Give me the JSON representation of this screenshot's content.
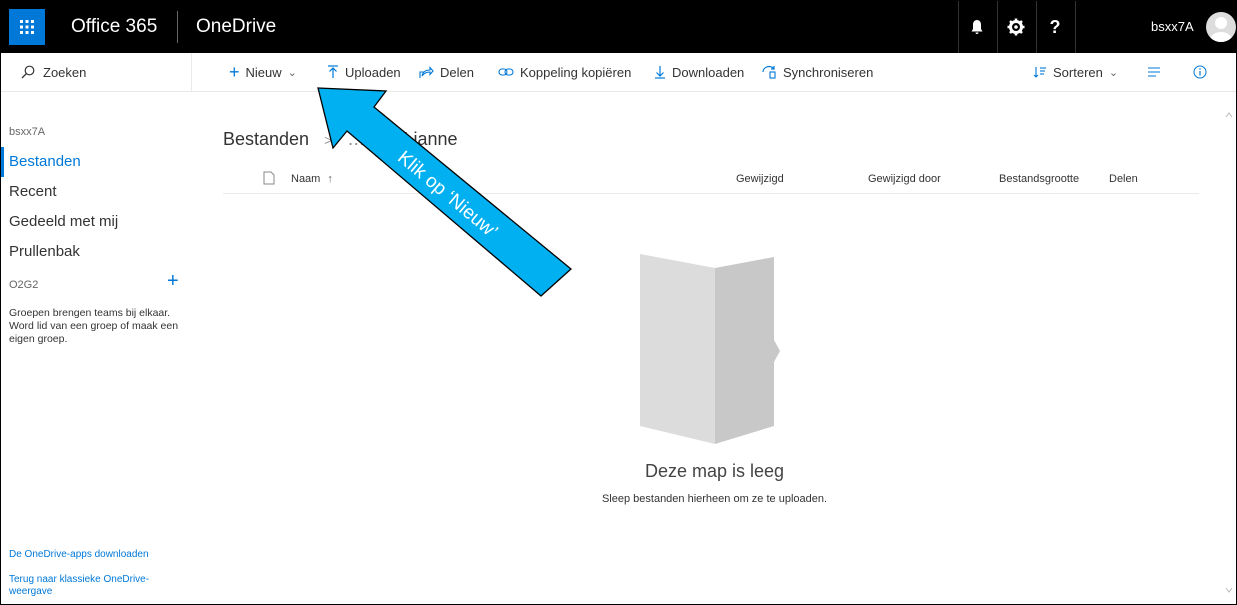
{
  "topbar": {
    "brand": "Office 365",
    "app_name": "OneDrive",
    "username": "bsxx7A",
    "icons": [
      "waffle-icon",
      "bell-icon",
      "gear-icon",
      "help-icon",
      "avatar"
    ]
  },
  "commandbar": {
    "search_placeholder": "Zoeken",
    "new": "Nieuw",
    "upload": "Uploaden",
    "share": "Delen",
    "copy_link": "Koppeling kopiëren",
    "download": "Downloaden",
    "sync": "Synchroniseren",
    "sort": "Sorteren"
  },
  "sidebar": {
    "user": "bsxx7A",
    "items": [
      {
        "label": "Bestanden",
        "active": true
      },
      {
        "label": "Recent"
      },
      {
        "label": "Gedeeld met mij"
      },
      {
        "label": "Prullenbak"
      }
    ],
    "groups_label": "O2G2",
    "groups_desc": "Groepen brengen teams bij elkaar. Word lid van een groep of maak een eigen groep.",
    "link_apps": "De OneDrive-apps downloaden",
    "link_classic": "Terug naar klassieke OneDrive-weergave"
  },
  "main": {
    "breadcrumb": [
      "Bestanden",
      "Lianne"
    ],
    "columns": {
      "name": "Naam",
      "modified": "Gewijzigd",
      "modified_by": "Gewijzigd door",
      "size": "Bestandsgrootte",
      "share": "Delen"
    },
    "empty_title": "Deze map is leeg",
    "empty_sub": "Sleep bestanden hierheen om ze te uploaden."
  },
  "annotation": {
    "text": "Klik op ‘Nieuw’",
    "color": "#00b0f0"
  },
  "colors": {
    "accent": "#0078d7",
    "topbar": "#000000"
  }
}
